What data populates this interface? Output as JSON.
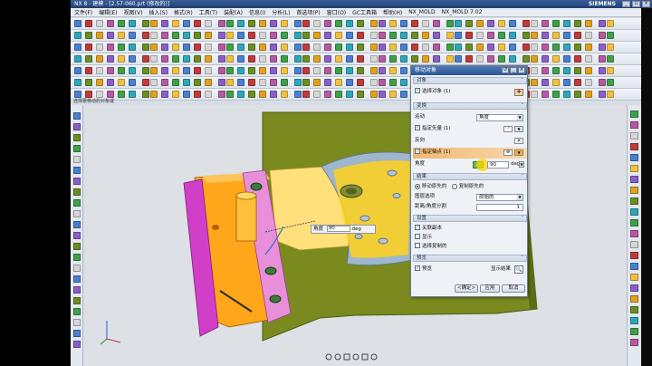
{
  "window": {
    "title": "NX 8 - 建模 - [2.57-060.prt (修改的)]",
    "brand": "SIEMENS",
    "controls": [
      "_",
      "▫",
      "×"
    ]
  },
  "menu": [
    "文件(F)",
    "编辑(E)",
    "视图(V)",
    "插入(S)",
    "格式(R)",
    "工具(T)",
    "装配(A)",
    "信息(I)",
    "分析(L)",
    "首选项(P)",
    "窗口(O)",
    "GC工具箱",
    "帮助(H)",
    "NX_MOLD",
    "NX_MOLD 7.02"
  ],
  "viewport": {
    "caption": "选择要移动的对象或",
    "input_label": "角度",
    "input_value": "90",
    "input_unit": "deg"
  },
  "dialog": {
    "title": "移动对象",
    "controls": [
      "↺",
      "_",
      "×"
    ],
    "sections": {
      "objects": "对象",
      "transform": "变换",
      "result": "结果",
      "settings": "设置",
      "preview": "预览"
    },
    "select_object_label": "选择对象 (1)",
    "motion_label": "运动",
    "motion_value": "角度",
    "vector_label": "指定矢量 (1)",
    "reverse_label": "反向",
    "axis_point_label": "指定轴点 (1)",
    "angle_label": "角度",
    "angle_value": "90",
    "angle_unit": "deg",
    "result_move": "移动原先的",
    "result_copy": "复制原先的",
    "layer_option_label": "图层选项",
    "layer_option_value": "原始的",
    "distance_label": "距离/角度分割",
    "distance_value": "1",
    "settings_items": [
      "关联副本",
      "显示",
      "选择复制的"
    ],
    "preview_label": "预览",
    "show_result_label": "显示结果",
    "ok_label": "<确定>",
    "apply_label": "应用",
    "cancel_label": "取消"
  },
  "colors": {
    "titlebar": "#2d558f",
    "green_block": "#7a8a1e",
    "yellow": "#ffd21a",
    "orange": "#ffa61a",
    "magenta": "#d13fc8",
    "pink": "#e98fd9",
    "blue_gray": "#9eb7cf"
  }
}
